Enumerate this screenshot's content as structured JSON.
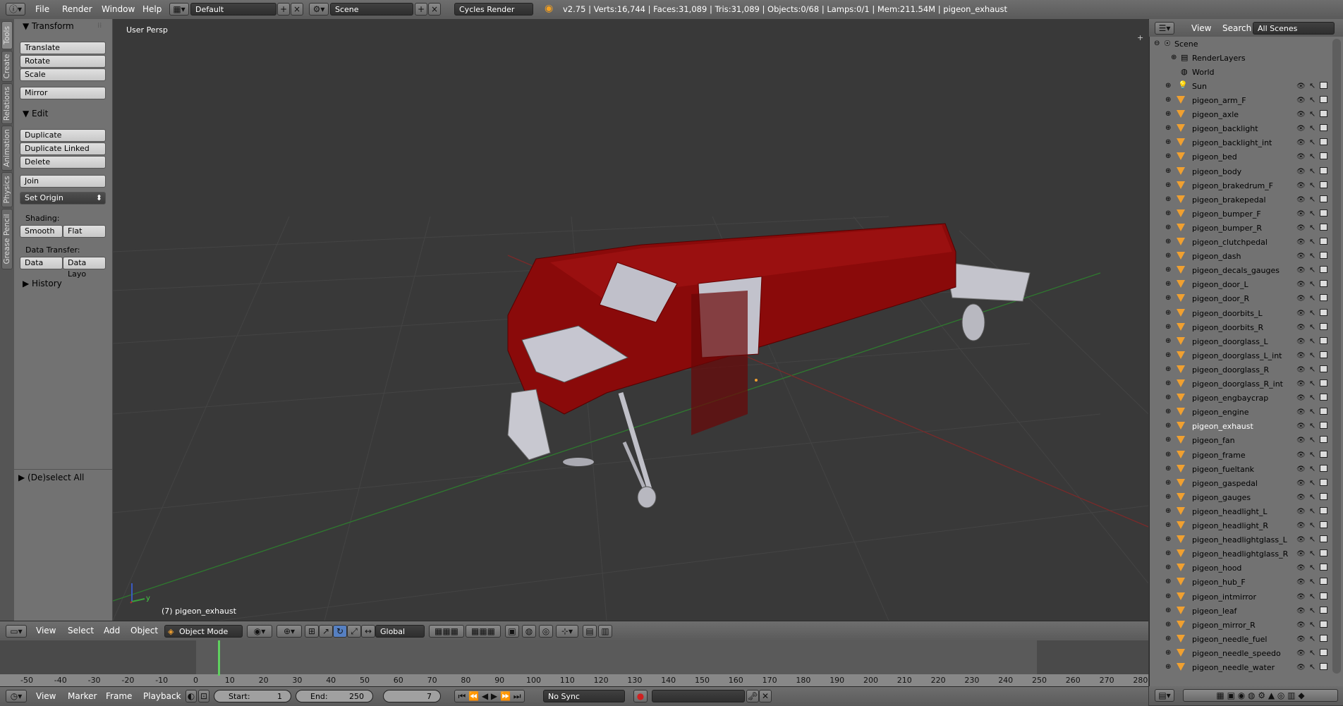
{
  "topbar": {
    "menus": [
      "File",
      "Render",
      "Window",
      "Help"
    ],
    "layout": "Default",
    "scene": "Scene",
    "engine": "Cycles Render",
    "stats": "v2.75 | Verts:16,744 | Faces:31,089 | Tris:31,089 | Objects:0/68 | Lamps:0/1 | Mem:211.54M | pigeon_exhaust"
  },
  "tabs": [
    "Tools",
    "Create",
    "Relations",
    "Animation",
    "Physics",
    "Grease Pencil"
  ],
  "toolshelf": {
    "transform_header": "Transform",
    "translate": "Translate",
    "rotate": "Rotate",
    "scale": "Scale",
    "mirror": "Mirror",
    "edit_header": "Edit",
    "duplicate": "Duplicate",
    "duplicate_linked": "Duplicate Linked",
    "delete": "Delete",
    "join": "Join",
    "set_origin": "Set Origin",
    "shading_label": "Shading:",
    "smooth": "Smooth",
    "flat": "Flat",
    "data_transfer_label": "Data Transfer:",
    "data": "Data",
    "data_layout": "Data Layo",
    "history_header": "History",
    "operator_panel": "(De)select All"
  },
  "viewport": {
    "label": "User Persp",
    "object_info": "(7) pigeon_exhaust",
    "axis_y": "y"
  },
  "vp_header": {
    "view": "View",
    "select": "Select",
    "add": "Add",
    "object": "Object",
    "mode": "Object Mode",
    "orientation": "Global"
  },
  "timeline": {
    "ticks": [
      "-50",
      "-40",
      "-30",
      "-20",
      "-10",
      "0",
      "10",
      "20",
      "30",
      "40",
      "50",
      "60",
      "70",
      "80",
      "90",
      "100",
      "110",
      "120",
      "130",
      "140",
      "150",
      "160",
      "170",
      "180",
      "190",
      "200",
      "210",
      "220",
      "230",
      "240",
      "250",
      "260",
      "270",
      "280"
    ],
    "current_frame": 7,
    "header": {
      "view": "View",
      "marker": "Marker",
      "frame": "Frame",
      "playback": "Playback",
      "start_label": "Start:",
      "start": "1",
      "end_label": "End:",
      "end": "250",
      "current": "7",
      "sync": "No Sync"
    }
  },
  "outliner": {
    "view": "View",
    "search": "Search",
    "display": "All Scenes",
    "scene": "Scene",
    "renderlayers": "RenderLayers",
    "world": "World",
    "sun": "Sun",
    "objects": [
      "pigeon_arm_F",
      "pigeon_axle",
      "pigeon_backlight",
      "pigeon_backlight_int",
      "pigeon_bed",
      "pigeon_body",
      "pigeon_brakedrum_F",
      "pigeon_brakepedal",
      "pigeon_bumper_F",
      "pigeon_bumper_R",
      "pigeon_clutchpedal",
      "pigeon_dash",
      "pigeon_decals_gauges",
      "pigeon_door_L",
      "pigeon_door_R",
      "pigeon_doorbits_L",
      "pigeon_doorbits_R",
      "pigeon_doorglass_L",
      "pigeon_doorglass_L_int",
      "pigeon_doorglass_R",
      "pigeon_doorglass_R_int",
      "pigeon_engbaycrap",
      "pigeon_engine",
      "pigeon_exhaust",
      "pigeon_fan",
      "pigeon_frame",
      "pigeon_fueltank",
      "pigeon_gaspedal",
      "pigeon_gauges",
      "pigeon_headlight_L",
      "pigeon_headlight_R",
      "pigeon_headlightglass_L",
      "pigeon_headlightglass_R",
      "pigeon_hood",
      "pigeon_hub_F",
      "pigeon_intmirror",
      "pigeon_leaf",
      "pigeon_mirror_R",
      "pigeon_needle_fuel",
      "pigeon_needle_speedo",
      "pigeon_needle_water"
    ],
    "selected": "pigeon_exhaust"
  },
  "colors": {
    "car_body": "#8a0a0a",
    "glass": "#b8b8c4",
    "grid_x": "#7a2a2a",
    "grid_y": "#2f7a2f",
    "frame_marker": "#5fd05f"
  }
}
